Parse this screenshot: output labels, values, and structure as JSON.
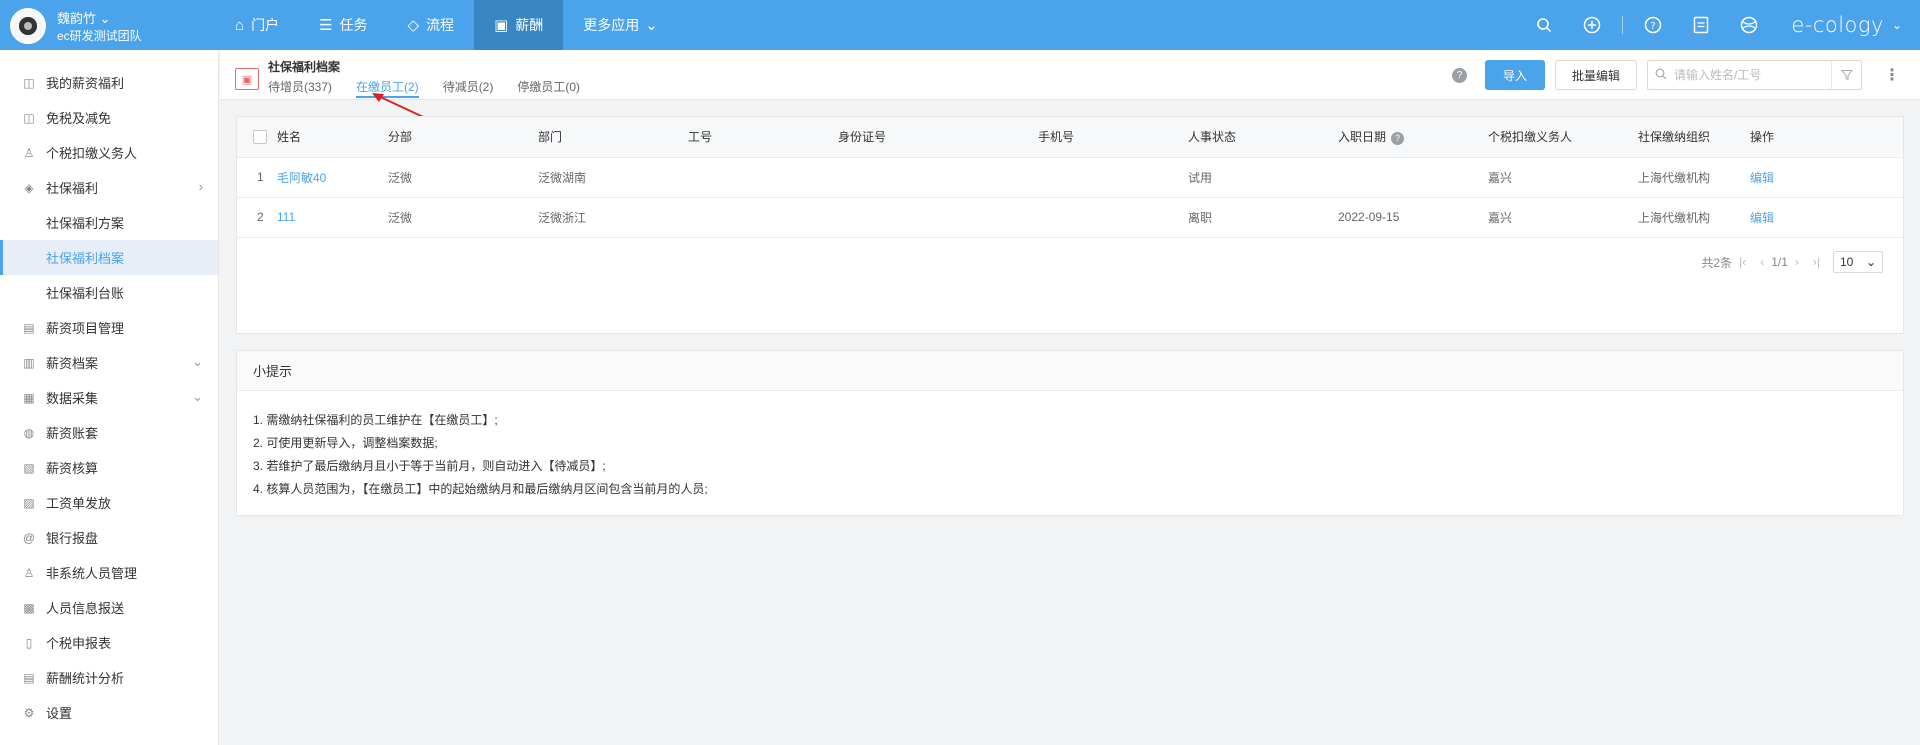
{
  "user": {
    "name": "魏韵竹",
    "team": "ec研发测试团队"
  },
  "nav": [
    {
      "icon": "home-icon",
      "glyph": "⌂",
      "label": "门户"
    },
    {
      "icon": "task-list-icon",
      "glyph": "☰",
      "label": "任务"
    },
    {
      "icon": "layers-icon",
      "glyph": "◇",
      "label": "流程"
    },
    {
      "icon": "salary-icon",
      "glyph": "▣",
      "label": "薪酬"
    },
    {
      "icon": "chevron-down-icon",
      "glyph": "⌄",
      "label": "更多应用"
    }
  ],
  "brand": "e-cology",
  "sidebar": [
    {
      "label": "我的薪资福利",
      "icon": "wallet-icon",
      "glyph": "◫"
    },
    {
      "label": "免税及减免",
      "icon": "wallet-icon",
      "glyph": "◫"
    },
    {
      "label": "个税扣缴义务人",
      "icon": "person-icon",
      "glyph": "♙"
    },
    {
      "label": "社保福利",
      "icon": "shield-icon",
      "glyph": "◈"
    },
    {
      "label": "社保福利方案"
    },
    {
      "label": "社保福利档案"
    },
    {
      "label": "社保福利台账"
    },
    {
      "label": "薪资项目管理",
      "icon": "project-icon",
      "glyph": "▤"
    },
    {
      "label": "薪资档案",
      "icon": "archive-icon",
      "glyph": "▥"
    },
    {
      "label": "数据采集",
      "icon": "data-collect-icon",
      "glyph": "▦"
    },
    {
      "label": "薪资账套",
      "icon": "ledger-icon",
      "glyph": "◍"
    },
    {
      "label": "薪资核算",
      "icon": "calculate-icon",
      "glyph": "▧"
    },
    {
      "label": "工资单发放",
      "icon": "payslip-icon",
      "glyph": "▨"
    },
    {
      "label": "银行报盘",
      "icon": "bank-icon",
      "glyph": "@"
    },
    {
      "label": "非系统人员管理",
      "icon": "person-icon",
      "glyph": "♙"
    },
    {
      "label": "人员信息报送",
      "icon": "report-icon",
      "glyph": "▩"
    },
    {
      "label": "个税申报表",
      "icon": "tax-form-icon",
      "glyph": "▯"
    },
    {
      "label": "薪酬统计分析",
      "icon": "statistics-icon",
      "glyph": "▤"
    },
    {
      "label": "设置",
      "icon": "settings-icon",
      "glyph": "⚙"
    }
  ],
  "header": {
    "title": "社保福利档案",
    "tabs": [
      "待增员(337)",
      "在缴员工(2)",
      "待减员(2)",
      "停缴员工(0)"
    ],
    "import_label": "导入",
    "batch_edit_label": "批量编辑",
    "search_placeholder": "请输入姓名/工号"
  },
  "table": {
    "columns": [
      "姓名",
      "分部",
      "部门",
      "工号",
      "身份证号",
      "手机号",
      "人事状态",
      "入职日期",
      "个税扣缴义务人",
      "社保缴纳组织",
      "操作"
    ],
    "rows": [
      {
        "index": "1",
        "name": "毛阿敏40",
        "branch": "泛微",
        "dept": "泛微湖南",
        "emp_no": "",
        "id_no": "",
        "phone": "",
        "status": "试用",
        "join_date": "",
        "tax_agent": "嘉兴",
        "org": "上海代缴机构",
        "action": "编辑"
      },
      {
        "index": "2",
        "name": "111",
        "branch": "泛微",
        "dept": "泛微浙江",
        "emp_no": "",
        "id_no": "",
        "phone": "",
        "status": "离职",
        "join_date": "2022-09-15",
        "tax_agent": "嘉兴",
        "org": "上海代缴机构",
        "action": "编辑"
      }
    ]
  },
  "pager": {
    "total": "共2条",
    "page": "1/1",
    "size": "10"
  },
  "tips": {
    "title": "小提示",
    "items": [
      "1. 需缴纳社保福利的员工维护在【在缴员工】;",
      "2. 可使用更新导入，调整档案数据;",
      "3. 若维护了最后缴纳月且小于等于当前月，则自动进入【待减员】;",
      "4. 核算人员范围为，【在缴员工】中的起始缴纳月和最后缴纳月区间包含当前月的人员;"
    ]
  }
}
